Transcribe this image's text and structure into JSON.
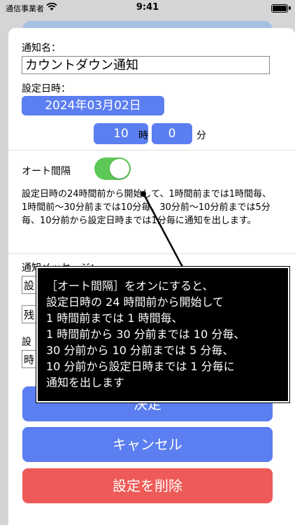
{
  "status_bar": {
    "carrier": "通信事業者",
    "time": "9:41"
  },
  "form": {
    "name_label": "通知名：",
    "name_value": "カウントダウン通知",
    "datetime_label": "設定日時：",
    "date_value": "2024年03月02日",
    "hour_value": "10",
    "hour_unit": "時",
    "minute_value": "0",
    "minute_unit": "分",
    "auto_interval_label": "オート間隔",
    "auto_interval_on": true,
    "auto_interval_description": "設定日時の24時間前から開始して、1時間前までは1時間毎、1時間前〜30分前までは10分毎、30分前〜10分前までは5分毎、10分前から設定日時までは1分毎に通知を出します。",
    "message_label": "通知メッセージ：",
    "message_field_1": "設",
    "message_field_2": "残",
    "label_3_partial": "設",
    "message_field_3": "時"
  },
  "buttons": {
    "decide": "決定",
    "cancel": "キャンセル",
    "delete": "設定を削除"
  },
  "tooltip": {
    "text": "［オート間隔］をオンにすると、\n設定日時の 24 時間前から開始して\n1 時間前までは 1 時間毎、\n1 時間前から 30 分前までは 10 分毎、\n30 分前から 10 分前までは 5 分毎、\n10 分前から設定日時までは 1 分毎に\n通知を出します"
  },
  "colors": {
    "accent_blue": "#5b7ef0",
    "toggle_green": "#5cc858",
    "delete_red": "#ee5a57"
  }
}
